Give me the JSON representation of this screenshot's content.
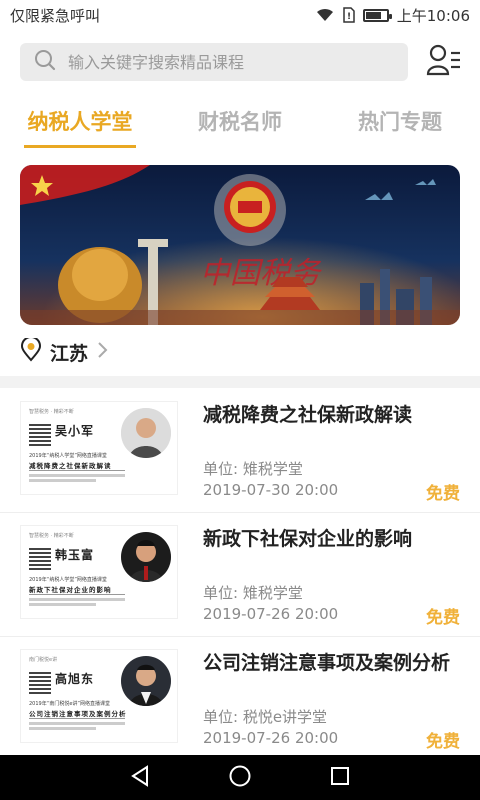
{
  "status_bar": {
    "carrier": "仅限紧急呼叫",
    "time": "上午10:06",
    "battery_level": 0.7
  },
  "search": {
    "placeholder": "输入关键字搜索精品课程"
  },
  "tabs": [
    {
      "label": "纳税人学堂",
      "active": true
    },
    {
      "label": "财税名师",
      "active": false
    },
    {
      "label": "热门专题",
      "active": false
    }
  ],
  "location": {
    "city": "江苏"
  },
  "courses": [
    {
      "title": "减税降费之社保新政解读",
      "unit": "单位: 雉税学堂",
      "date": "2019-07-30 20:00",
      "price": "免费",
      "thumb": {
        "name": "吴小军",
        "line1": "2019年“纳税人学堂”网络直播课堂",
        "line2": "减税降费之社保新政解读"
      }
    },
    {
      "title": "新政下社保对企业的影响",
      "unit": "单位: 雉税学堂",
      "date": "2019-07-26 20:00",
      "price": "免费",
      "thumb": {
        "name": "韩玉富",
        "line1": "2019年“纳税人学堂”网络直播课堂",
        "line2": "新政下社保对企业的影响"
      }
    },
    {
      "title": "公司注销注意事项及案例分析",
      "unit": "单位: 税悦e讲学堂",
      "date": "2019-07-26 20:00",
      "price": "免费",
      "thumb": {
        "name": "高旭东",
        "line1": "2019年“南门税悦e讲”网络直播课堂",
        "line2": "公司注销注意事项及案例分析"
      }
    }
  ],
  "colors": {
    "accent": "#e9a823",
    "price": "#f0b13a",
    "inactive_tab": "#b4b4b4"
  }
}
